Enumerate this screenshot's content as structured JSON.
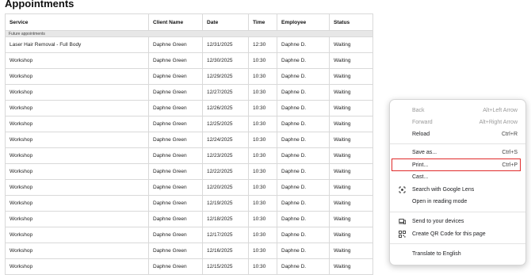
{
  "page": {
    "title": "Appointments"
  },
  "table": {
    "headers": [
      "Service",
      "Client Name",
      "Date",
      "Time",
      "Employee",
      "Status"
    ],
    "group_label": "Future appointments",
    "rows": [
      [
        "Laser Hair Removal - Full Body",
        "Daphne Green",
        "12/31/2025",
        "12:30",
        "Daphne D.",
        "Waiting"
      ],
      [
        "Workshop",
        "Daphne Green",
        "12/30/2025",
        "10:30",
        "Daphne D.",
        "Waiting"
      ],
      [
        "Workshop",
        "Daphne Green",
        "12/29/2025",
        "10:30",
        "Daphne D.",
        "Waiting"
      ],
      [
        "Workshop",
        "Daphne Green",
        "12/27/2025",
        "10:30",
        "Daphne D.",
        "Waiting"
      ],
      [
        "Workshop",
        "Daphne Green",
        "12/26/2025",
        "10:30",
        "Daphne D.",
        "Waiting"
      ],
      [
        "Workshop",
        "Daphne Green",
        "12/25/2025",
        "10:30",
        "Daphne D.",
        "Waiting"
      ],
      [
        "Workshop",
        "Daphne Green",
        "12/24/2025",
        "10:30",
        "Daphne D.",
        "Waiting"
      ],
      [
        "Workshop",
        "Daphne Green",
        "12/23/2025",
        "10:30",
        "Daphne D.",
        "Waiting"
      ],
      [
        "Workshop",
        "Daphne Green",
        "12/22/2025",
        "10:30",
        "Daphne D.",
        "Waiting"
      ],
      [
        "Workshop",
        "Daphne Green",
        "12/20/2025",
        "10:30",
        "Daphne D.",
        "Waiting"
      ],
      [
        "Workshop",
        "Daphne Green",
        "12/19/2025",
        "10:30",
        "Daphne D.",
        "Waiting"
      ],
      [
        "Workshop",
        "Daphne Green",
        "12/18/2025",
        "10:30",
        "Daphne D.",
        "Waiting"
      ],
      [
        "Workshop",
        "Daphne Green",
        "12/17/2025",
        "10:30",
        "Daphne D.",
        "Waiting"
      ],
      [
        "Workshop",
        "Daphne Green",
        "12/16/2025",
        "10:30",
        "Daphne D.",
        "Waiting"
      ],
      [
        "Workshop",
        "Daphne Green",
        "12/15/2025",
        "10:30",
        "Daphne D.",
        "Waiting"
      ]
    ]
  },
  "context_menu": {
    "back": {
      "label": "Back",
      "shortcut": "Alt+Left Arrow"
    },
    "forward": {
      "label": "Forward",
      "shortcut": "Alt+Right Arrow"
    },
    "reload": {
      "label": "Reload",
      "shortcut": "Ctrl+R"
    },
    "save_as": {
      "label": "Save as...",
      "shortcut": "Ctrl+S"
    },
    "print": {
      "label": "Print...",
      "shortcut": "Ctrl+P"
    },
    "cast": {
      "label": "Cast..."
    },
    "search_lens": {
      "label": "Search with Google Lens",
      "icon": "google-lens-icon"
    },
    "reading_mode": {
      "label": "Open in reading mode"
    },
    "send_devices": {
      "label": "Send to your devices",
      "icon": "laptop-phone-icon"
    },
    "qr_code": {
      "label": "Create QR Code for this page",
      "icon": "qr-code-icon"
    },
    "translate": {
      "label": "Translate to English"
    }
  },
  "colors": {
    "highlight": "#e02a2a",
    "group_row_bg": "#e7e7e7",
    "grid": "#d9d9d9"
  }
}
